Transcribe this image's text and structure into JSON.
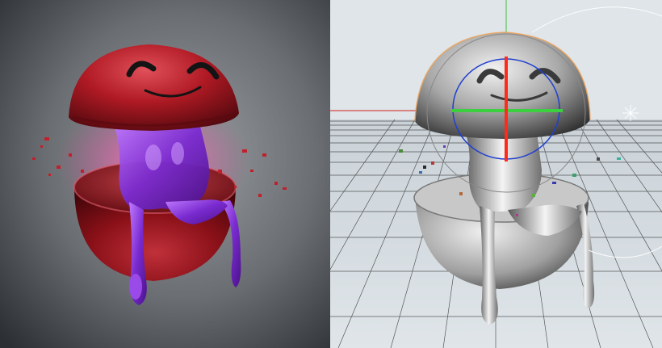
{
  "panels": [
    {
      "id": "render",
      "description_name": "final-render",
      "background": [
        "#2f3337",
        "#8a8d91",
        "#c8cacc"
      ],
      "colors": {
        "shell": "#b01a24",
        "shell_dark": "#5a0a10",
        "shell_highlight": "#e0505a",
        "slime": "#7a2bd0",
        "slime_light": "#b56cff",
        "glow": "#d04090",
        "face": "#1a1a1a"
      }
    },
    {
      "id": "viewport",
      "description_name": "3d-viewport-clay",
      "background": [
        "#c3ccd3",
        "#dfe5e9"
      ],
      "colors": {
        "grid": "#2a2a2a",
        "clay": "#d8d8d8",
        "clay_dark": "#3a3a3a",
        "axis_y": "#ff2a1a",
        "axis_x": "#3cd040",
        "axis_z": "#2040d0",
        "horizon_x": "#e04040",
        "gizmo_ring": "#888888",
        "selection": "#f0a050",
        "y_axis_line": "#40c040",
        "x_axis_line": "#d02020"
      }
    }
  ]
}
